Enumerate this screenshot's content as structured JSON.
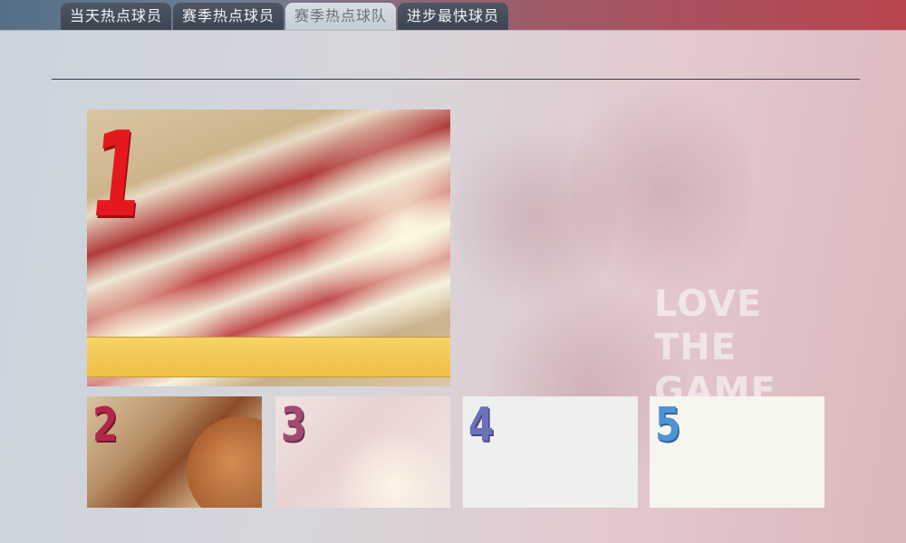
{
  "tabs": [
    {
      "label": "当天热点球员",
      "active": false
    },
    {
      "label": "赛季热点球员",
      "active": false
    },
    {
      "label": "赛季热点球队",
      "active": true
    },
    {
      "label": "进步最快球员",
      "active": false
    }
  ],
  "background_text": "LOVE\nTHE\nGAME",
  "ranking": {
    "main": {
      "rank": "1",
      "color": "#e5171f"
    },
    "cards": [
      {
        "rank": "2",
        "color": "#b0274a"
      },
      {
        "rank": "3",
        "color": "#a14b72"
      },
      {
        "rank": "4",
        "color": "#6b72b6"
      },
      {
        "rank": "5",
        "color": "#4f93d4"
      }
    ]
  }
}
